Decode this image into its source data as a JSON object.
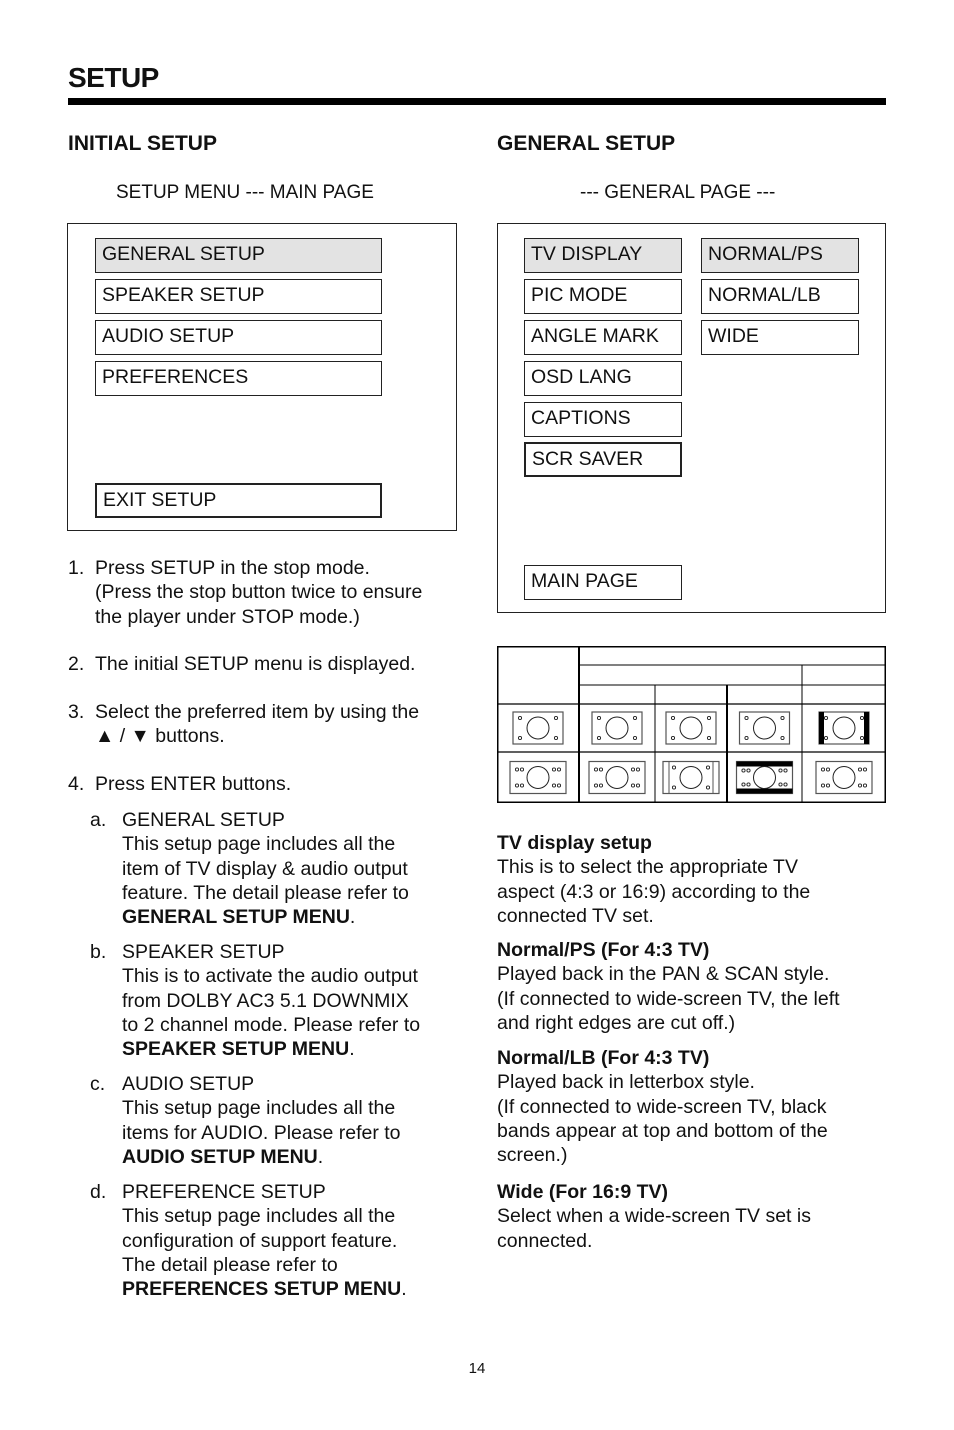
{
  "page": {
    "title": "SETUP",
    "page_number": "14"
  },
  "initial_setup": {
    "heading": "INITIAL SETUP",
    "menu_caption": "SETUP MENU --- MAIN PAGE",
    "menu_items": [
      {
        "label": "GENERAL SETUP",
        "selected": true
      },
      {
        "label": "SPEAKER SETUP",
        "selected": false
      },
      {
        "label": "AUDIO SETUP",
        "selected": false
      },
      {
        "label": "PREFERENCES",
        "selected": false
      }
    ],
    "exit_label": "EXIT SETUP",
    "steps": [
      {
        "num": "1.",
        "lines": [
          "Press SETUP in the stop mode.",
          "(Press the stop button twice to ensure",
          "the player under STOP mode.)"
        ]
      },
      {
        "num": "2.",
        "lines": [
          "The initial SETUP menu is displayed."
        ]
      },
      {
        "num": "3.",
        "lines": [
          "Select the preferred item by using the",
          "▲ / ▼ buttons."
        ]
      },
      {
        "num": "4.",
        "lines": [
          "Press ENTER buttons."
        ]
      }
    ],
    "substeps": [
      {
        "letter": "a.",
        "title": "GENERAL SETUP",
        "lines": [
          "This setup page includes all the",
          "item of TV display & audio output",
          "feature.  The detail please refer to"
        ],
        "ref": "GENERAL SETUP MENU"
      },
      {
        "letter": "b.",
        "title": "SPEAKER SETUP",
        "lines": [
          "This is to activate the audio output",
          "from DOLBY AC3 5.1 DOWNMIX",
          "to 2 channel mode.  Please refer to"
        ],
        "ref": "SPEAKER SETUP MENU"
      },
      {
        "letter": "c.",
        "title": "AUDIO SETUP",
        "lines": [
          "This setup page includes all the",
          "items for AUDIO.  Please refer to"
        ],
        "ref": "AUDIO SETUP MENU"
      },
      {
        "letter": "d.",
        "title": "PREFERENCE SETUP",
        "lines": [
          "This setup page includes all the",
          "configuration of support feature.",
          "The detail please refer to"
        ],
        "ref": "PREFERENCES SETUP MENU"
      }
    ]
  },
  "general_setup": {
    "heading": "GENERAL SETUP",
    "menu_caption": "--- GENERAL PAGE ---",
    "menu_items": [
      {
        "label": "TV DISPLAY",
        "selected": true
      },
      {
        "label": "PIC MODE",
        "selected": false
      },
      {
        "label": "ANGLE MARK",
        "selected": false
      },
      {
        "label": "OSD LANG",
        "selected": false
      },
      {
        "label": "CAPTIONS",
        "selected": false
      },
      {
        "label": "SCR SAVER",
        "selected": false
      }
    ],
    "options": [
      {
        "label": "NORMAL/PS",
        "selected": true
      },
      {
        "label": "NORMAL/LB",
        "selected": false
      },
      {
        "label": "WIDE",
        "selected": false
      }
    ],
    "main_page_label": "MAIN PAGE",
    "aspect_table": {
      "rows": [
        [
          "tv-4-3-icon",
          "tv-4-3-icon",
          "tv-4-3-icon",
          "tv-4-3-icon",
          "tv-4-3-pillarbox-icon"
        ],
        [
          "tv-16-9-icon",
          "tv-16-9-icon",
          "tv-16-9-cropped-icon",
          "tv-16-9-letterbox-icon",
          "tv-16-9-icon"
        ]
      ]
    },
    "descriptions": [
      {
        "title": "TV display setup",
        "lines": [
          "This is to select the appropriate TV",
          "aspect (4:3 or 16:9) according to the",
          "connected TV set."
        ]
      },
      {
        "title": "Normal/PS (For 4:3 TV)",
        "lines": [
          "Played back in the PAN & SCAN style.",
          "(If connected to wide-screen TV, the left",
          "and right edges are cut off.)"
        ]
      },
      {
        "title": "Normal/LB (For 4:3 TV)",
        "lines": [
          "Played back in letterbox style.",
          "(If connected to wide-screen TV, black",
          "bands appear at top and bottom of the",
          "screen.)"
        ]
      },
      {
        "title": "Wide (For 16:9 TV)",
        "lines": [
          "Select when a wide-screen TV set is",
          "connected."
        ]
      }
    ]
  }
}
